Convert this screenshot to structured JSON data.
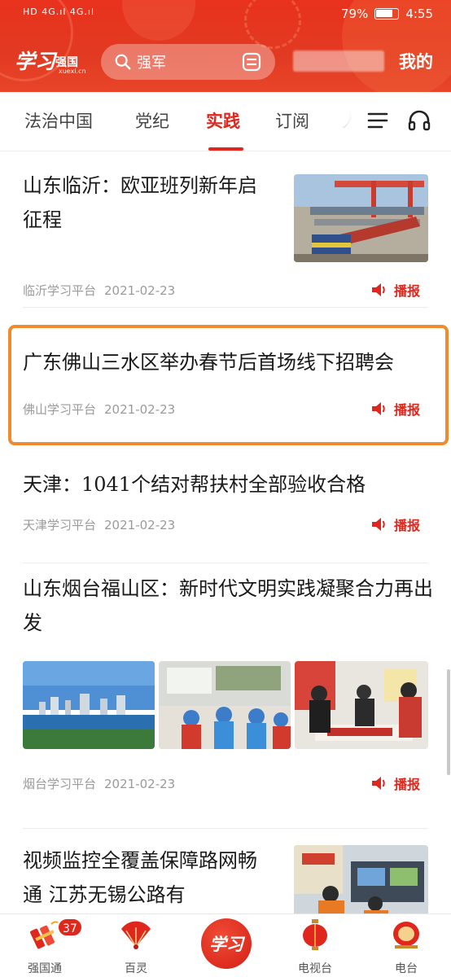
{
  "status_bar": {
    "left_indicators": "HD 4G.ıl 4G.ıl",
    "battery": "79%",
    "time": "4:55"
  },
  "header": {
    "logo_script": "学习",
    "logo_name": "强国",
    "logo_domain": "xuexi.cn",
    "search_value": "强军",
    "mine_label": "我的",
    "accent_color": "#e23a22"
  },
  "tabs": [
    "法治中国",
    "党纪",
    "实践",
    "订阅",
    "人"
  ],
  "active_tab": "实践",
  "feed": [
    {
      "title": "山东临沂：欧亚班列新年启征程",
      "source": "临沂学习平台",
      "date": "2021-02-23",
      "action": "播报"
    },
    {
      "title": "广东佛山三水区举办春节后首场线下招聘会",
      "source": "佛山学习平台",
      "date": "2021-02-23",
      "action": "播报"
    },
    {
      "title": "天津：1041个结对帮扶村全部验收合格",
      "source": "天津学习平台",
      "date": "2021-02-23",
      "action": "播报"
    },
    {
      "title": "山东烟台福山区：新时代文明实践凝聚合力再出发",
      "source": "烟台学习平台",
      "date": "2021-02-23",
      "action": "播报"
    },
    {
      "title": "视频监控全覆盖保障路网畅通 江苏无锡公路有",
      "source": "",
      "date": "",
      "action": ""
    }
  ],
  "bottom_nav": [
    {
      "label": "强国通",
      "badge": "37"
    },
    {
      "label": "百灵"
    },
    {
      "label": "学习"
    },
    {
      "label": "电视台"
    },
    {
      "label": "电台"
    }
  ],
  "highlight_color": "#f08a2c"
}
